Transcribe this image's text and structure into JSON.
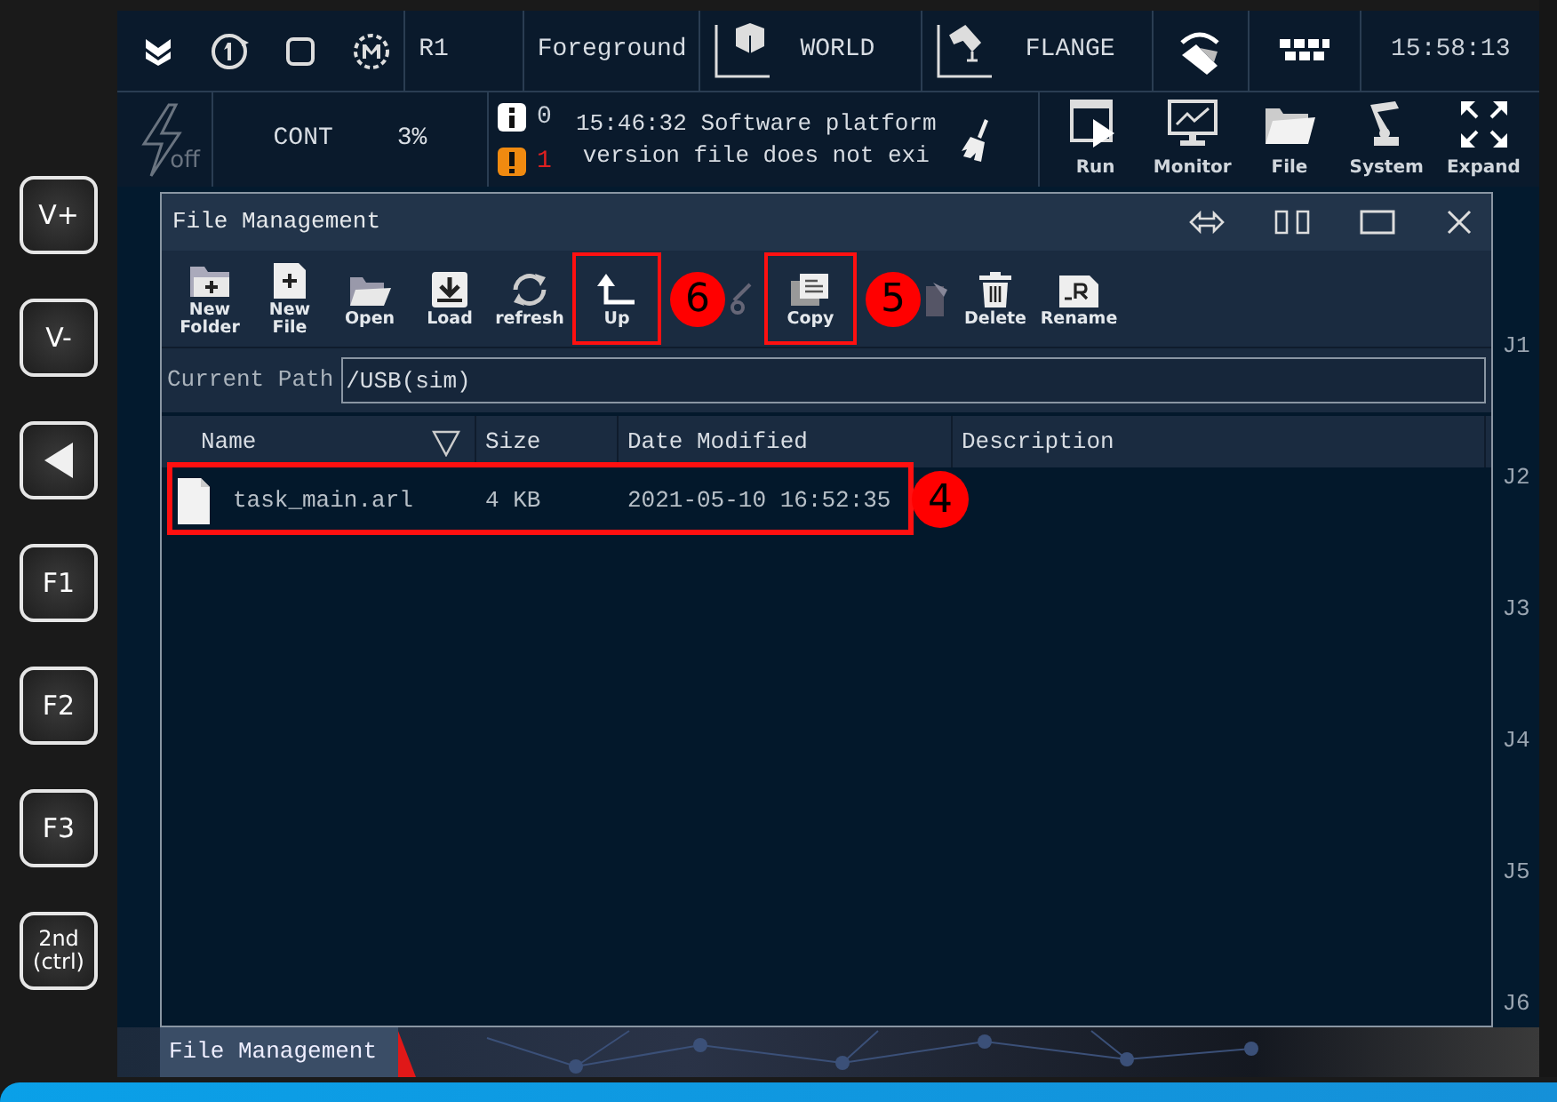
{
  "side_keys": [
    {
      "kind": "text",
      "label": "V+"
    },
    {
      "kind": "text",
      "label": "V-"
    },
    {
      "kind": "arrow"
    },
    {
      "kind": "text",
      "label": "F1"
    },
    {
      "kind": "text",
      "label": "F2"
    },
    {
      "kind": "text",
      "label": "F3"
    },
    {
      "kind": "text",
      "label": "2nd (ctrl)"
    }
  ],
  "top_bar": {
    "robot": "R1",
    "task": "Foreground",
    "coord_frame": "WORLD",
    "tool_frame": "FLANGE",
    "time": "15:58:13"
  },
  "status_row": {
    "power_label": "off",
    "motion_mode": "CONT",
    "speed": "3%",
    "info_count": "0",
    "warning_count": "1",
    "message": "15:46:32 Software platform version file does not exi"
  },
  "nav": [
    {
      "kind": "run",
      "label": "Run"
    },
    {
      "kind": "monitor",
      "label": "Monitor"
    },
    {
      "kind": "file",
      "label": "File"
    },
    {
      "kind": "system",
      "label": "System"
    },
    {
      "kind": "expand",
      "label": "Expand"
    }
  ],
  "window": {
    "title": "File Management",
    "toolbar": [
      {
        "kind": "new-folder",
        "label": "New Folder"
      },
      {
        "kind": "new-file",
        "label": "New File"
      },
      {
        "kind": "open",
        "label": "Open"
      },
      {
        "kind": "load",
        "label": "Load"
      },
      {
        "kind": "refresh",
        "label": "refresh"
      },
      {
        "kind": "up",
        "label": "Up",
        "annotation": "6"
      },
      {
        "kind": "cut"
      },
      {
        "kind": "copy",
        "label": "Copy",
        "annotation": "5"
      },
      {
        "kind": "paste"
      },
      {
        "kind": "delete",
        "label": "Delete"
      },
      {
        "kind": "rename",
        "label": "Rename"
      }
    ],
    "path": {
      "label": "Current Path",
      "value": "/USB(sim)"
    },
    "table": {
      "columns": [
        "Name",
        "Size",
        "Date Modified",
        "Description"
      ],
      "rows": [
        {
          "name": "task_main.arl",
          "size": "4 KB",
          "date_modified": "2021-05-10 16:52:35",
          "annotation": "4"
        }
      ]
    }
  },
  "joints": [
    "J1",
    "J2",
    "J3",
    "J4",
    "J5",
    "J6"
  ],
  "taskbar": {
    "tab": "File Management"
  }
}
